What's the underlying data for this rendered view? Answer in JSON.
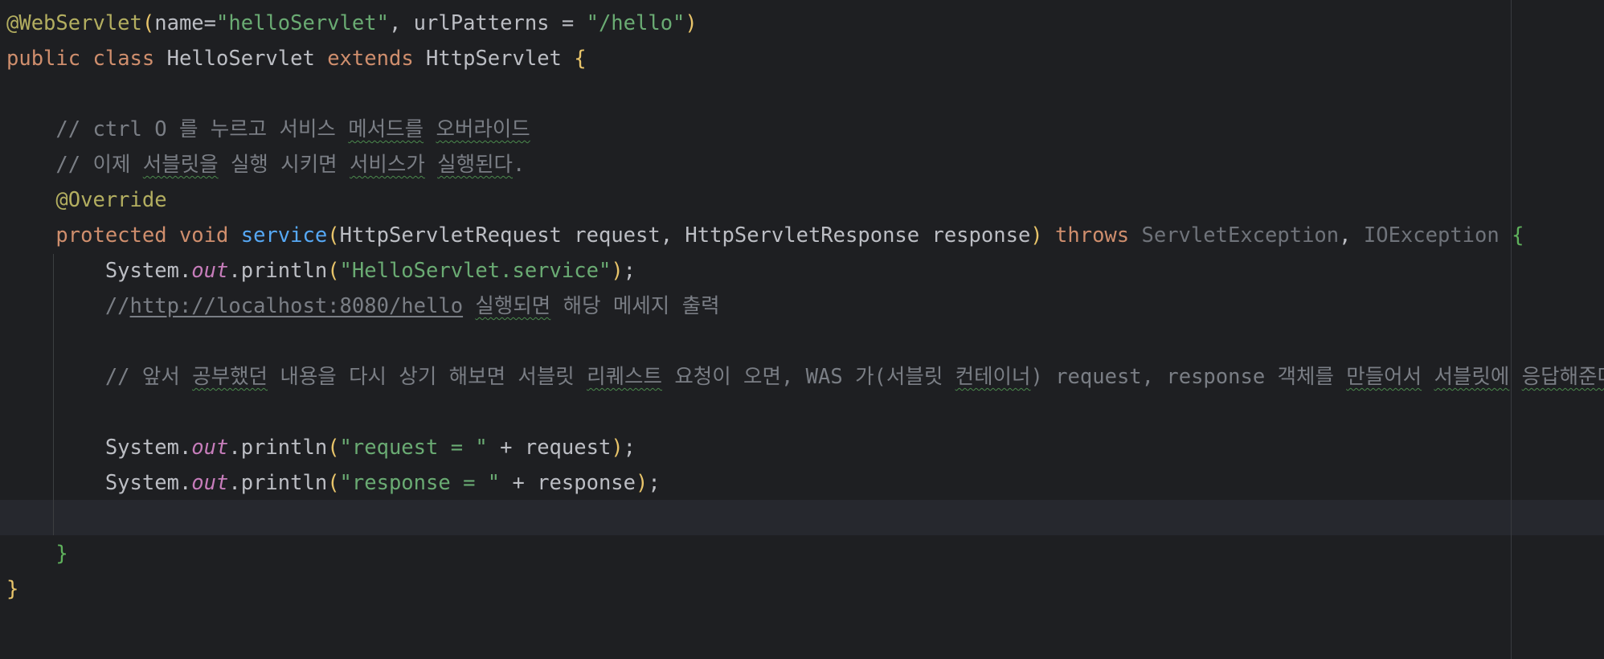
{
  "code": {
    "l1": {
      "annotation": "@WebServlet",
      "open_paren": "(",
      "attr_name": "name=",
      "attr_name_value": "\"helloServlet\"",
      "sep": ", urlPatterns = ",
      "attr_pattern_value": "\"/hello\"",
      "close_paren": ")"
    },
    "l2": {
      "kw_public": "public",
      "kw_class": "class",
      "class_name": "HelloServlet",
      "kw_extends": "extends",
      "super_name": "HttpServlet",
      "open_brace": "{"
    },
    "l4": {
      "prefix": "// ctrl O 를 누르고 서비스 ",
      "w1": "메서드를",
      "space": " ",
      "w2": "오버라이드"
    },
    "l5": {
      "prefix": "// 이제 ",
      "w1": "서블릿을",
      "mid": " 실행 시키면 ",
      "w2": "서비스가",
      "space": " ",
      "w3": "실행된다",
      "suffix": "."
    },
    "l6": {
      "annotation": "@Override"
    },
    "l7": {
      "kw_protected": "protected",
      "kw_void": "void",
      "method_name": "service",
      "open_paren": "(",
      "params": "HttpServletRequest request, HttpServletResponse response",
      "close_paren": ")",
      "kw_throws": "throws",
      "exc1": "ServletException",
      "comma": ", ",
      "exc2": "IOException",
      "open_brace": "{"
    },
    "l8": {
      "obj": "System.",
      "field": "out",
      "call": ".println",
      "open_paren": "(",
      "string": "\"HelloServlet.service\"",
      "close_paren": ")",
      "semi": ";"
    },
    "l9": {
      "slashes": "//",
      "url": "http://localhost:8080/hello",
      "space": " ",
      "w1": "실행되면",
      "suffix": " 해당 메세지 출력"
    },
    "l11": {
      "p1": "// 앞서 ",
      "w1": "공부했던",
      "p2": " 내용을 다시 상기 해보면 서블릿 ",
      "w2": "리퀘스트",
      "p3": " 요청이 오면, WAS 가(서블릿 ",
      "w3": "컨테이너",
      "p4": ") request, response 객체를 ",
      "w4": "만들어서",
      "space": " ",
      "w5": "서블릿에",
      "space2": " ",
      "w6": "응답해준다",
      "suffix": "."
    },
    "l13": {
      "obj": "System.",
      "field": "out",
      "call": ".println",
      "open_paren": "(",
      "string": "\"request = \"",
      "concat": " + request",
      "close_paren": ")",
      "semi": ";"
    },
    "l14": {
      "obj": "System.",
      "field": "out",
      "call": ".println",
      "open_paren": "(",
      "string": "\"response = \"",
      "concat": " + response",
      "close_paren": ")",
      "semi": ";"
    },
    "l16": {
      "close_brace": "}"
    },
    "l17": {
      "close_brace": "}"
    }
  },
  "colors": {
    "background": "#1e1f22",
    "keyword": "#cf8e6d",
    "annotation": "#b3ae60",
    "string": "#6aab73",
    "comment": "#7a7e85",
    "method": "#56a8f5",
    "static_field": "#c77dbb"
  }
}
